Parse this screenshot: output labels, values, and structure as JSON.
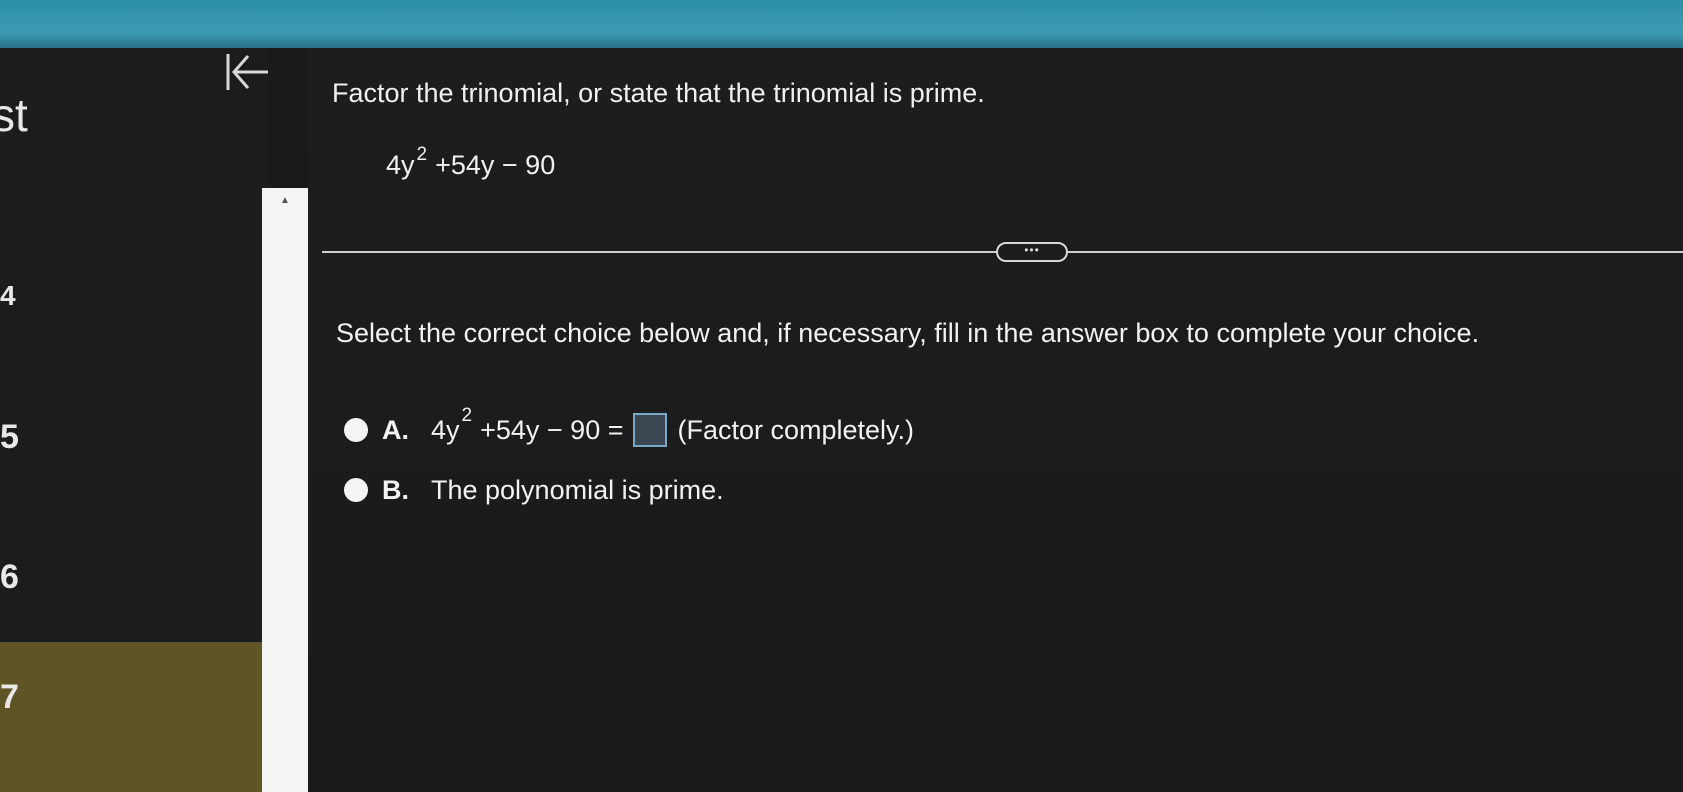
{
  "sidebar": {
    "title": "st",
    "items": [
      {
        "label": "4"
      },
      {
        "label": "5"
      },
      {
        "label": "6"
      },
      {
        "label": "7"
      }
    ]
  },
  "question": {
    "instruction": "Factor the trinomial, or state that the trinomial is prime.",
    "expression": {
      "base": "4y",
      "exponent": "2",
      "rest": "+54y − 90"
    },
    "more_label": "•••",
    "prompt": "Select the correct choice below and, if necessary, fill in the answer box to complete your choice.",
    "choices": [
      {
        "letter": "A.",
        "expr_base": "4y",
        "expr_exponent": "2",
        "expr_rest": "+54y − 90 =",
        "hint": "(Factor completely.)",
        "answer_value": ""
      },
      {
        "letter": "B.",
        "text": "The polynomial is prime."
      }
    ]
  },
  "colors": {
    "topbar": "#3a9bb3",
    "selected_nav": "#5e5426",
    "background": "#1a1a1b"
  }
}
